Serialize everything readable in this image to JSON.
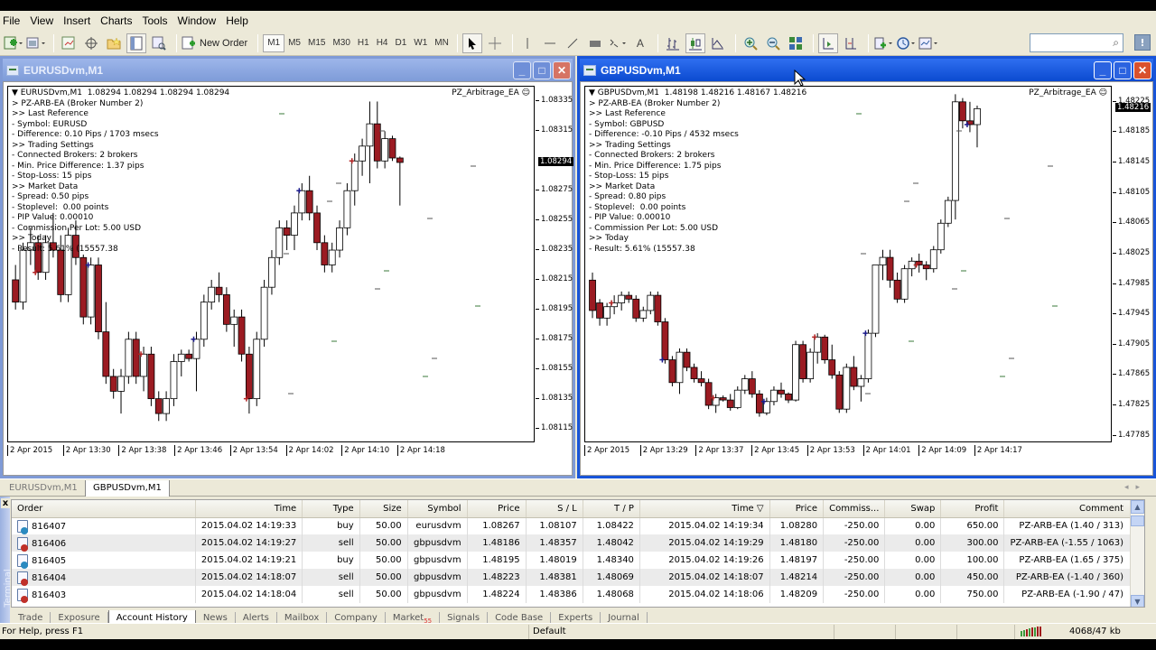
{
  "menubar": [
    "File",
    "View",
    "Insert",
    "Charts",
    "Tools",
    "Window",
    "Help"
  ],
  "toolbar": {
    "new_order_label": "New Order",
    "timeframes": [
      "M1",
      "M5",
      "M15",
      "M30",
      "H1",
      "H4",
      "D1",
      "W1",
      "MN"
    ],
    "active_timeframe": "M1",
    "search_placeholder": ""
  },
  "windows": [
    {
      "id": "eur",
      "title": "EURUSDvm,M1",
      "active": false,
      "ea_label": "PZ_Arbitrage_EA ☺",
      "info_lines": [
        "▼ EURUSDvm,M1  1.08294 1.08294 1.08294 1.08294",
        "> PZ-ARB-EA (Broker Number 2)",
        ">> Last Reference",
        "- Symbol: EURUSD",
        "- Difference: 0.10 Pips / 1703 msecs",
        ">> Trading Settings",
        "- Connected Brokers: 2 brokers",
        "- Min. Price Difference: 1.37 pips",
        "- Stop-Loss: 15 pips",
        ">> Market Data",
        "- Spread: 0.50 pips",
        "- Stoplevel:  0.00 points",
        "- PIP Value: 0.00010",
        "- Commission Per Lot: 5.00 USD",
        ">> Today",
        "- Result: 5.61% (15557.38"
      ],
      "current_price": "1.08294",
      "y_ticks": [
        "1.08335",
        "1.08315",
        "1.08275",
        "1.08255",
        "1.08235",
        "1.08215",
        "1.08195",
        "1.08175",
        "1.08155",
        "1.08135",
        "1.08115"
      ],
      "x_ticks": [
        "2 Apr 2015",
        "2 Apr 13:30",
        "2 Apr 13:38",
        "2 Apr 13:46",
        "2 Apr 13:54",
        "2 Apr 14:02",
        "2 Apr 14:10",
        "2 Apr 14:18"
      ]
    },
    {
      "id": "gbp",
      "title": "GBPUSDvm,M1",
      "active": true,
      "ea_label": "PZ_Arbitrage_EA ☺",
      "info_lines": [
        "▼ GBPUSDvm,M1  1.48198 1.48216 1.48167 1.48216",
        "> PZ-ARB-EA (Broker Number 2)",
        ">> Last Reference",
        "- Symbol: GBPUSD",
        "- Difference: -0.10 Pips / 4532 msecs",
        ">> Trading Settings",
        "- Connected Brokers: 2 brokers",
        "- Min. Price Difference: 1.75 pips",
        "- Stop-Loss: 15 pips",
        ">> Market Data",
        "- Spread: 0.80 pips",
        "- Stoplevel:  0.00 points",
        "- PIP Value: 0.00010",
        "- Commission Per Lot: 5.00 USD",
        ">> Today",
        "- Result: 5.61% (15557.38"
      ],
      "current_price": "1.48216",
      "y_ticks": [
        "1.48225",
        "1.48185",
        "1.48145",
        "1.48105",
        "1.48065",
        "1.48025",
        "1.47985",
        "1.47945",
        "1.47905",
        "1.47865",
        "1.47825",
        "1.47785"
      ],
      "x_ticks": [
        "2 Apr 2015",
        "2 Apr 13:29",
        "2 Apr 13:37",
        "2 Apr 13:45",
        "2 Apr 13:53",
        "2 Apr 14:01",
        "2 Apr 14:09",
        "2 Apr 14:17"
      ]
    }
  ],
  "chart_tabs": [
    "EURUSDvm,M1",
    "GBPUSDvm,M1"
  ],
  "active_chart_tab": "GBPUSDvm,M1",
  "terminal": {
    "side_label": "Terminal",
    "close_label": "x",
    "columns": [
      "Order",
      "Time",
      "Type",
      "Size",
      "Symbol",
      "Price",
      "S / L",
      "T / P",
      "Time ▽",
      "Price",
      "Commiss...",
      "Swap",
      "Profit",
      "Comment"
    ],
    "rows": [
      {
        "order": "816407",
        "open_time": "2015.04.02 14:19:33",
        "type": "buy",
        "size": "50.00",
        "symbol": "eurusdvm",
        "price": "1.08267",
        "sl": "1.08107",
        "tp": "1.08422",
        "close_time": "2015.04.02 14:19:34",
        "close_price": "1.08280",
        "commission": "-250.00",
        "swap": "0.00",
        "profit": "650.00",
        "comment": "PZ-ARB-EA (1.40 / 313)"
      },
      {
        "order": "816406",
        "open_time": "2015.04.02 14:19:27",
        "type": "sell",
        "size": "50.00",
        "symbol": "gbpusdvm",
        "price": "1.48186",
        "sl": "1.48357",
        "tp": "1.48042",
        "close_time": "2015.04.02 14:19:29",
        "close_price": "1.48180",
        "commission": "-250.00",
        "swap": "0.00",
        "profit": "300.00",
        "comment": "PZ-ARB-EA (-1.55 / 1063)"
      },
      {
        "order": "816405",
        "open_time": "2015.04.02 14:19:21",
        "type": "buy",
        "size": "50.00",
        "symbol": "gbpusdvm",
        "price": "1.48195",
        "sl": "1.48019",
        "tp": "1.48340",
        "close_time": "2015.04.02 14:19:26",
        "close_price": "1.48197",
        "commission": "-250.00",
        "swap": "0.00",
        "profit": "100.00",
        "comment": "PZ-ARB-EA (1.65 / 375)"
      },
      {
        "order": "816404",
        "open_time": "2015.04.02 14:18:07",
        "type": "sell",
        "size": "50.00",
        "symbol": "gbpusdvm",
        "price": "1.48223",
        "sl": "1.48381",
        "tp": "1.48069",
        "close_time": "2015.04.02 14:18:07",
        "close_price": "1.48214",
        "commission": "-250.00",
        "swap": "0.00",
        "profit": "450.00",
        "comment": "PZ-ARB-EA (-1.40 / 360)"
      },
      {
        "order": "816403",
        "open_time": "2015.04.02 14:18:04",
        "type": "sell",
        "size": "50.00",
        "symbol": "gbpusdvm",
        "price": "1.48224",
        "sl": "1.48386",
        "tp": "1.48068",
        "close_time": "2015.04.02 14:18:06",
        "close_price": "1.48209",
        "commission": "-250.00",
        "swap": "0.00",
        "profit": "750.00",
        "comment": "PZ-ARB-EA (-1.90 / 47)"
      }
    ],
    "tabs": [
      "Trade",
      "Exposure",
      "Account History",
      "News",
      "Alerts",
      "Mailbox",
      "Company",
      "Market",
      "Signals",
      "Code Base",
      "Experts",
      "Journal"
    ],
    "active_tab": "Account History",
    "market_badge": "55"
  },
  "statusbar": {
    "help": "For Help, press F1",
    "profile": "Default",
    "traffic": "4068/47 kb"
  },
  "colors": {
    "bear_candle": "#9b1b22",
    "bull_candle": "#ffffff",
    "sell_arrow": "#b22222",
    "buy_arrow": "#1a1a8c",
    "stop_mark": "#e6e050",
    "active_title": "#0b4ad0",
    "inactive_title": "#7f9ad6"
  },
  "chart_data": [
    {
      "type": "candlestick",
      "title": "EURUSDvm,M1",
      "ylim": [
        1.08105,
        1.08345
      ],
      "y_ticks": [
        1.08335,
        1.08315,
        1.08275,
        1.08255,
        1.08235,
        1.08215,
        1.08195,
        1.08175,
        1.08155,
        1.08135,
        1.08115
      ],
      "current": 1.08294,
      "x_ticks": [
        "2 Apr 2015",
        "2 Apr 13:30",
        "2 Apr 13:38",
        "2 Apr 13:46",
        "2 Apr 13:54",
        "2 Apr 14:02",
        "2 Apr 14:10",
        "2 Apr 14:18"
      ],
      "candles_ohlc": [
        [
          1.08215,
          1.08225,
          1.08195,
          1.082
        ],
        [
          1.082,
          1.0824,
          1.08195,
          1.08235
        ],
        [
          1.08235,
          1.0825,
          1.08225,
          1.0824
        ],
        [
          1.0824,
          1.08245,
          1.08215,
          1.0822
        ],
        [
          1.0822,
          1.08245,
          1.08215,
          1.0824
        ],
        [
          1.0824,
          1.0826,
          1.0823,
          1.08235
        ],
        [
          1.08235,
          1.08245,
          1.082,
          1.08205
        ],
        [
          1.08205,
          1.0825,
          1.082,
          1.08245
        ],
        [
          1.08245,
          1.08255,
          1.08225,
          1.0823
        ],
        [
          1.0823,
          1.08232,
          1.08185,
          1.0819
        ],
        [
          1.0819,
          1.0823,
          1.08185,
          1.08225
        ],
        [
          1.08225,
          1.0823,
          1.08175,
          1.0818
        ],
        [
          1.0818,
          1.082,
          1.08145,
          1.0815
        ],
        [
          1.0815,
          1.08155,
          1.08135,
          1.0814
        ],
        [
          1.0814,
          1.08155,
          1.08125,
          1.0815
        ],
        [
          1.0815,
          1.0818,
          1.08145,
          1.08175
        ],
        [
          1.08175,
          1.0818,
          1.08145,
          1.0815
        ],
        [
          1.0815,
          1.0817,
          1.0814,
          1.08165
        ],
        [
          1.08165,
          1.0817,
          1.0813,
          1.08135
        ],
        [
          1.08135,
          1.0814,
          1.0812,
          1.08125
        ],
        [
          1.08125,
          1.0814,
          1.0812,
          1.08135
        ],
        [
          1.08135,
          1.08165,
          1.0813,
          1.0816
        ],
        [
          1.0816,
          1.08168,
          1.0815,
          1.08165
        ],
        [
          1.08165,
          1.08168,
          1.0816,
          1.08162
        ],
        [
          1.08162,
          1.0818,
          1.0814,
          1.08175
        ],
        [
          1.08175,
          1.08205,
          1.0817,
          1.082
        ],
        [
          1.082,
          1.08215,
          1.08195,
          1.0821
        ],
        [
          1.0821,
          1.0822,
          1.082,
          1.08205
        ],
        [
          1.08205,
          1.0821,
          1.0818,
          1.08185
        ],
        [
          1.08185,
          1.08195,
          1.0817,
          1.0819
        ],
        [
          1.0819,
          1.08195,
          1.0816,
          1.08165
        ],
        [
          1.08165,
          1.0817,
          1.08125,
          1.08135
        ],
        [
          1.08135,
          1.0818,
          1.0813,
          1.08175
        ],
        [
          1.08175,
          1.08215,
          1.0817,
          1.0821
        ],
        [
          1.0821,
          1.08235,
          1.08205,
          1.0823
        ],
        [
          1.0823,
          1.08255,
          1.08225,
          1.0825
        ],
        [
          1.0825,
          1.08255,
          1.08235,
          1.08245
        ],
        [
          1.08245,
          1.08265,
          1.08235,
          1.0826
        ],
        [
          1.0826,
          1.0828,
          1.08255,
          1.08275
        ],
        [
          1.08275,
          1.08285,
          1.08255,
          1.0826
        ],
        [
          1.0826,
          1.08265,
          1.08235,
          1.0824
        ],
        [
          1.0824,
          1.08245,
          1.0822,
          1.08225
        ],
        [
          1.08225,
          1.0824,
          1.0822,
          1.08235
        ],
        [
          1.08235,
          1.08255,
          1.0823,
          1.0825
        ],
        [
          1.0825,
          1.0828,
          1.08245,
          1.08275
        ],
        [
          1.08275,
          1.083,
          1.08265,
          1.08295
        ],
        [
          1.08295,
          1.0831,
          1.08285,
          1.08305
        ],
        [
          1.08305,
          1.08335,
          1.0828,
          1.0832
        ],
        [
          1.0832,
          1.08335,
          1.0829,
          1.08295
        ],
        [
          1.08295,
          1.08315,
          1.0829,
          1.0831
        ],
        [
          1.0831,
          1.08312,
          1.08295,
          1.08297
        ],
        [
          1.08297,
          1.08298,
          1.08265,
          1.08294
        ]
      ]
    },
    {
      "type": "candlestick",
      "title": "GBPUSDvm,M1",
      "ylim": [
        1.47775,
        1.48245
      ],
      "y_ticks": [
        1.48225,
        1.48185,
        1.48145,
        1.48105,
        1.48065,
        1.48025,
        1.47985,
        1.47945,
        1.47905,
        1.47865,
        1.47825,
        1.47785
      ],
      "current": 1.48216,
      "x_ticks": [
        "2 Apr 2015",
        "2 Apr 13:29",
        "2 Apr 13:37",
        "2 Apr 13:45",
        "2 Apr 13:53",
        "2 Apr 14:01",
        "2 Apr 14:09",
        "2 Apr 14:17"
      ],
      "candles_ohlc": [
        [
          1.4799,
          1.48,
          1.4794,
          1.4795
        ],
        [
          1.4796,
          1.47965,
          1.4793,
          1.4794
        ],
        [
          1.4794,
          1.4796,
          1.4793,
          1.47955
        ],
        [
          1.47955,
          1.4797,
          1.47945,
          1.4796
        ],
        [
          1.4796,
          1.47975,
          1.4795,
          1.4797
        ],
        [
          1.4797,
          1.47975,
          1.4796,
          1.47965
        ],
        [
          1.47965,
          1.4797,
          1.47935,
          1.4794
        ],
        [
          1.4794,
          1.47955,
          1.47935,
          1.4795
        ],
        [
          1.4795,
          1.47975,
          1.47945,
          1.4797
        ],
        [
          1.4797,
          1.47975,
          1.4793,
          1.47935
        ],
        [
          1.47935,
          1.4794,
          1.4788,
          1.47885
        ],
        [
          1.47885,
          1.4789,
          1.4785,
          1.47855
        ],
        [
          1.47855,
          1.479,
          1.4784,
          1.47895
        ],
        [
          1.47895,
          1.479,
          1.4787,
          1.47875
        ],
        [
          1.47875,
          1.4788,
          1.47855,
          1.4786
        ],
        [
          1.4786,
          1.4787,
          1.4785,
          1.47855
        ],
        [
          1.47855,
          1.4786,
          1.4782,
          1.47825
        ],
        [
          1.47825,
          1.4784,
          1.47815,
          1.47835
        ],
        [
          1.47835,
          1.47838,
          1.4783,
          1.47832
        ],
        [
          1.47832,
          1.4784,
          1.47818,
          1.47822
        ],
        [
          1.47822,
          1.4785,
          1.4782,
          1.47845
        ],
        [
          1.47845,
          1.47865,
          1.4784,
          1.4786
        ],
        [
          1.4786,
          1.4787,
          1.47835,
          1.4784
        ],
        [
          1.4784,
          1.47845,
          1.4781,
          1.47815
        ],
        [
          1.47815,
          1.47835,
          1.47812,
          1.4783
        ],
        [
          1.4783,
          1.4785,
          1.47825,
          1.47845
        ],
        [
          1.47845,
          1.47855,
          1.47835,
          1.4784
        ],
        [
          1.4784,
          1.47842,
          1.47828,
          1.47832
        ],
        [
          1.47832,
          1.4791,
          1.4783,
          1.47905
        ],
        [
          1.47905,
          1.4791,
          1.47855,
          1.4786
        ],
        [
          1.4786,
          1.479,
          1.47855,
          1.47895
        ],
        [
          1.47895,
          1.4792,
          1.4788,
          1.47915
        ],
        [
          1.47915,
          1.47918,
          1.4788,
          1.47885
        ],
        [
          1.47885,
          1.47905,
          1.4786,
          1.47865
        ],
        [
          1.47865,
          1.4787,
          1.47815,
          1.4782
        ],
        [
          1.4782,
          1.4788,
          1.47815,
          1.47875
        ],
        [
          1.47875,
          1.4789,
          1.47845,
          1.4785
        ],
        [
          1.4785,
          1.47865,
          1.4783,
          1.4786
        ],
        [
          1.4786,
          1.47925,
          1.47855,
          1.4792
        ],
        [
          1.4792,
          1.4798,
          1.47915,
          1.4801
        ],
        [
          1.4801,
          1.4803,
          1.4799,
          1.4802
        ],
        [
          1.4802,
          1.4803,
          1.4798,
          1.4799
        ],
        [
          1.4799,
          1.48,
          1.4796,
          1.47965
        ],
        [
          1.47965,
          1.4801,
          1.4796,
          1.48005
        ],
        [
          1.48005,
          1.4802,
          1.47995,
          1.48015
        ],
        [
          1.48015,
          1.48025,
          1.48,
          1.4801
        ],
        [
          1.4801,
          1.48015,
          1.4799,
          1.48005
        ],
        [
          1.48005,
          1.48035,
          1.48,
          1.4803
        ],
        [
          1.4803,
          1.4807,
          1.48025,
          1.48065
        ],
        [
          1.48065,
          1.481,
          1.4806,
          1.48095
        ],
        [
          1.48095,
          1.48235,
          1.4807,
          1.48225
        ],
        [
          1.48225,
          1.4823,
          1.4819,
          1.482
        ],
        [
          1.482,
          1.48225,
          1.48185,
          1.48195
        ],
        [
          1.48195,
          1.4822,
          1.48165,
          1.48216
        ]
      ]
    }
  ]
}
